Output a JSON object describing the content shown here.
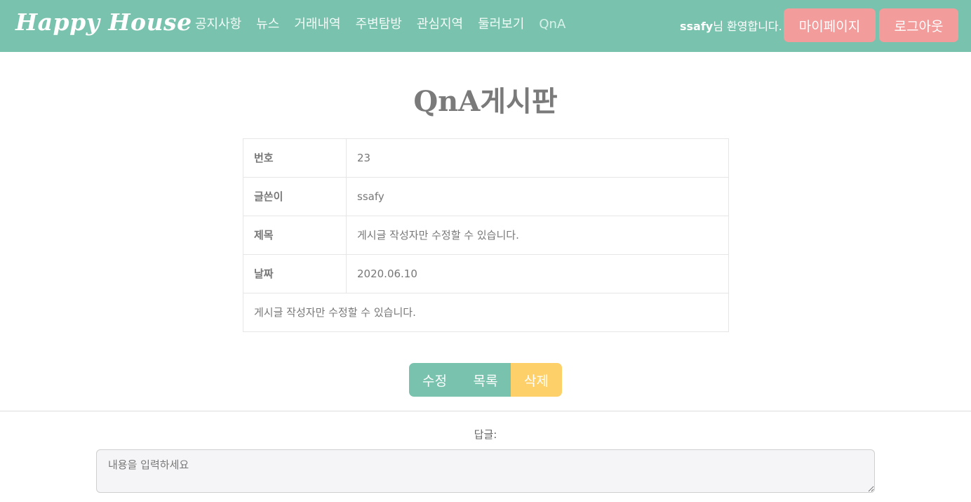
{
  "header": {
    "brand": "Happy House",
    "nav": [
      "공지사항",
      "뉴스",
      "거래내역",
      "주변탐방",
      "관심지역",
      "둘러보기",
      "QnA"
    ],
    "welcome_user": "ssafy",
    "welcome_suffix": "님 환영합니다.",
    "mypage_label": "마이페이지",
    "logout_label": "로그아웃",
    "colors": {
      "navbar": "#79c3ae",
      "header_button": "#f29c9c"
    }
  },
  "page": {
    "title": "QnA게시판"
  },
  "post": {
    "rows": [
      {
        "label": "번호",
        "value": "23"
      },
      {
        "label": "글쓴이",
        "value": "ssafy"
      },
      {
        "label": "제목",
        "value": "게시글 작성자만 수정할 수 있습니다."
      },
      {
        "label": "날짜",
        "value": "2020.06.10"
      }
    ],
    "content": "게시글 작성자만 수정할 수 있습니다."
  },
  "actions": {
    "edit_label": "수정",
    "list_label": "목록",
    "delete_label": "삭제",
    "colors": {
      "primary": "#79c3ae",
      "warning": "#fdd069"
    }
  },
  "reply": {
    "label": "답글:",
    "placeholder": "내용을 입력하세요"
  }
}
